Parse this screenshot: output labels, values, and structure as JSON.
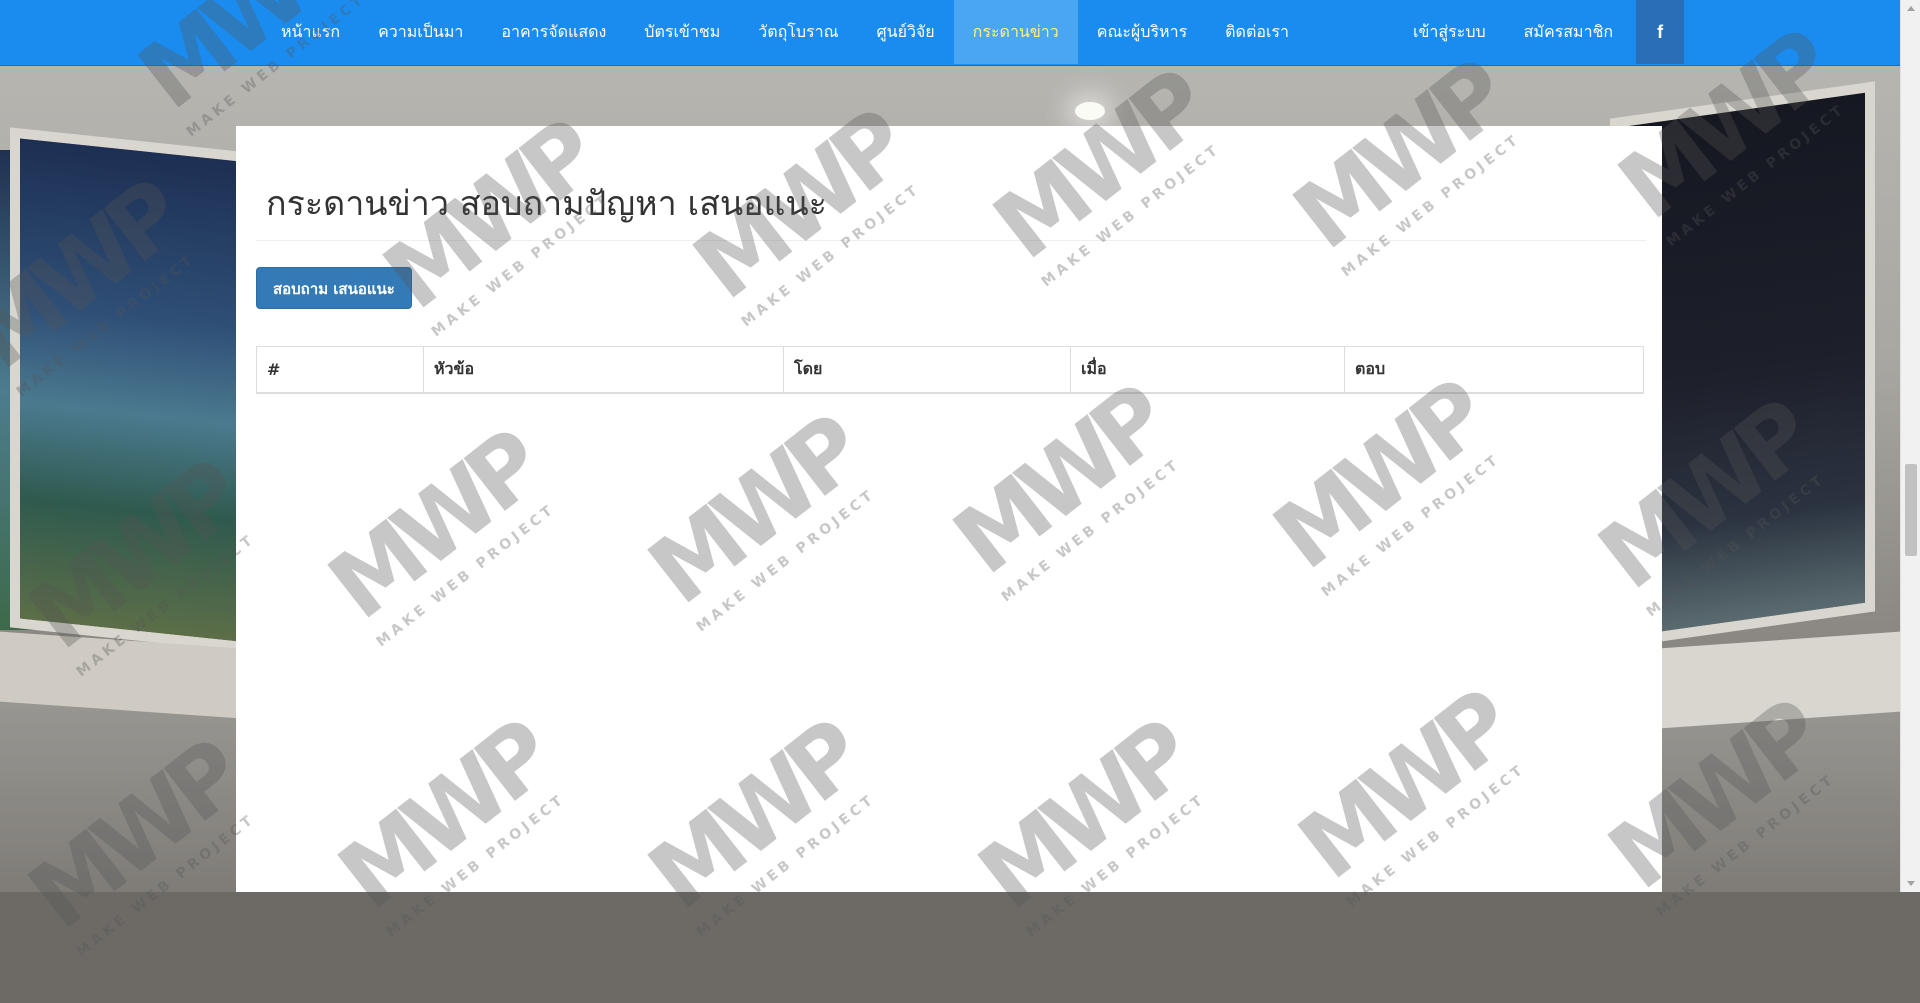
{
  "navbar": {
    "left_items": [
      {
        "label": "หน้าแรก",
        "active": false
      },
      {
        "label": "ความเป็นมา",
        "active": false
      },
      {
        "label": "อาคารจัดแสดง",
        "active": false
      },
      {
        "label": "บัตรเข้าชม",
        "active": false
      },
      {
        "label": "วัตถุโบราณ",
        "active": false
      },
      {
        "label": "ศูนย์วิจัย",
        "active": false
      },
      {
        "label": "กระดานข่าว",
        "active": true
      },
      {
        "label": "คณะผู้บริหาร",
        "active": false
      },
      {
        "label": "ติดต่อเรา",
        "active": false
      }
    ],
    "login_label": "เข้าสู่ระบบ",
    "register_label": "สมัครสมาชิก",
    "facebook_glyph": "f"
  },
  "main": {
    "title": "กระดานข่าว สอบถามปัญหา เสนอแนะ",
    "ask_button_label": "สอบถาม เสนอแนะ",
    "table_headers": [
      "#",
      "หัวข้อ",
      "โดย",
      "เมื่อ",
      "ตอบ"
    ]
  },
  "watermark": {
    "logo": "MWP",
    "subtitle": "MAKE WEB PROJECT"
  },
  "colors": {
    "navbar_bg": "#1a8cf0",
    "nav_active_bg": "#4aa5f2",
    "nav_active_text": "#fff27a",
    "facebook_bg": "#286fb8",
    "button_primary": "#337ab7"
  }
}
